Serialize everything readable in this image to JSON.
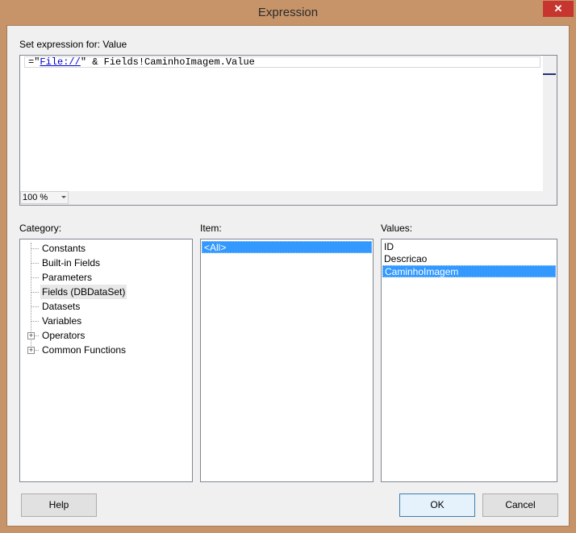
{
  "window": {
    "title": "Expression",
    "close_glyph": "✕"
  },
  "expression": {
    "label": "Set expression for: Value",
    "prefix": "=\"",
    "link_text": "File://",
    "suffix": "\" & Fields!CaminhoImagem.Value",
    "zoom": "100 %"
  },
  "category": {
    "label": "Category:",
    "items": [
      {
        "label": "Constants"
      },
      {
        "label": "Built-in Fields"
      },
      {
        "label": "Parameters"
      },
      {
        "label": "Fields (DBDataSet)"
      },
      {
        "label": "Datasets"
      },
      {
        "label": "Variables"
      },
      {
        "label": "Operators"
      },
      {
        "label": "Common Functions"
      }
    ],
    "selected": "Fields (DBDataSet)"
  },
  "item": {
    "label": "Item:",
    "items": [
      "<All>"
    ],
    "selected": "<All>"
  },
  "values": {
    "label": "Values:",
    "items": [
      "ID",
      "Descricao",
      "CaminhoImagem"
    ],
    "selected": "CaminhoImagem"
  },
  "buttons": {
    "help": "Help",
    "ok": "OK",
    "cancel": "Cancel"
  },
  "colors": {
    "frame": "#c7946a",
    "close": "#c7362e",
    "selection": "#3399ff"
  }
}
